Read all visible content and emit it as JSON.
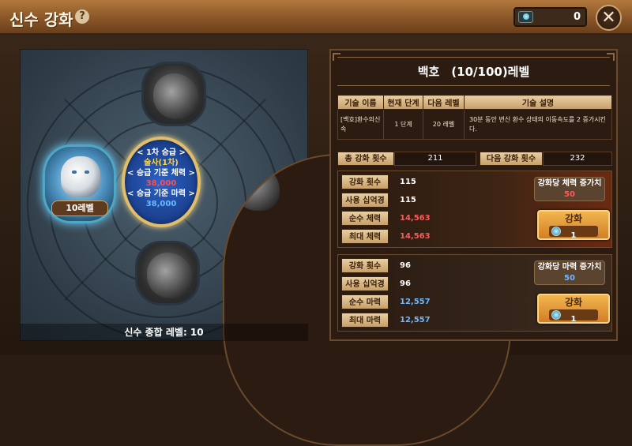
{
  "header": {
    "title": "신수 강화",
    "help_icon": "?",
    "currency_amount": "0",
    "close_icon": "✕"
  },
  "left_panel": {
    "selected_level": "10레벨",
    "center_info": {
      "line1": "< 1차 승급 >",
      "line2": "술사(1차)",
      "line3": "< 승급 기준 체력 >",
      "line4": "38,000",
      "line5": "< 승급 기준 마력 >",
      "line6": "38,000"
    },
    "total_level": "신수 종합 레벨: 10"
  },
  "right_panel": {
    "title": "백호　(10/100)레벨",
    "skill_table": {
      "headers": [
        "기술 이름",
        "현재 단계",
        "다음 레벨",
        "기술 설명"
      ],
      "row": {
        "name": "[백호]환수의신속",
        "current": "1 단계",
        "next": "20 레벨",
        "desc": "30분 동안 변신 환수 상태의 이동속도를 2 증가시킨다."
      }
    },
    "totals": {
      "total_label": "총 강화 횟수",
      "total_value": "211",
      "next_label": "다음 강화 횟수",
      "next_value": "232"
    },
    "hp_box": {
      "labels": [
        "강화 횟수",
        "사용 십억경",
        "순수 체력",
        "최대 체력"
      ],
      "values": [
        "115",
        "115",
        "14,563",
        "14,563"
      ],
      "increase_title": "강화당 체력 증가치",
      "increase_value": "50",
      "button_label": "강화",
      "button_cost": "1"
    },
    "mp_box": {
      "labels": [
        "강화 횟수",
        "사용 십억경",
        "순수 마력",
        "최대 마력"
      ],
      "values": [
        "96",
        "96",
        "12,557",
        "12,557"
      ],
      "increase_title": "강화당 마력 증가치",
      "increase_value": "50",
      "button_label": "강화",
      "button_cost": "1"
    }
  }
}
